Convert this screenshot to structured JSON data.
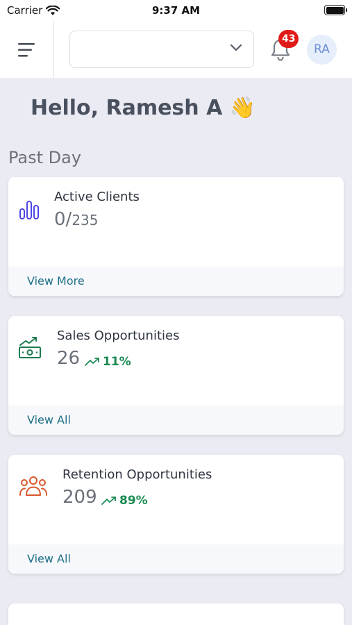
{
  "status_bar": {
    "carrier": "Carrier",
    "time": "9:37 AM"
  },
  "header": {
    "dropdown_value": "",
    "notification_count": "43",
    "avatar_initials": "RA"
  },
  "greeting": "Hello, Ramesh A 👋",
  "period": "Past Day",
  "cards": [
    {
      "title": "Active Clients",
      "value": "0/",
      "total": "235",
      "link": "View More",
      "icon": "bar-chart-icon",
      "color": "#4f46e5"
    },
    {
      "title": "Sales Opportunities",
      "value": "26",
      "trend": "11%",
      "link": "View All",
      "icon": "money-growth-icon",
      "color": "#1a7a4c"
    },
    {
      "title": "Retention Opportunities",
      "value": "209",
      "trend": "89%",
      "link": "View All",
      "icon": "users-group-icon",
      "color": "#d9552a"
    }
  ],
  "colors": {
    "accent": "#1d6f86",
    "trend_up": "#1a8a52",
    "badge": "#e11a1a"
  }
}
